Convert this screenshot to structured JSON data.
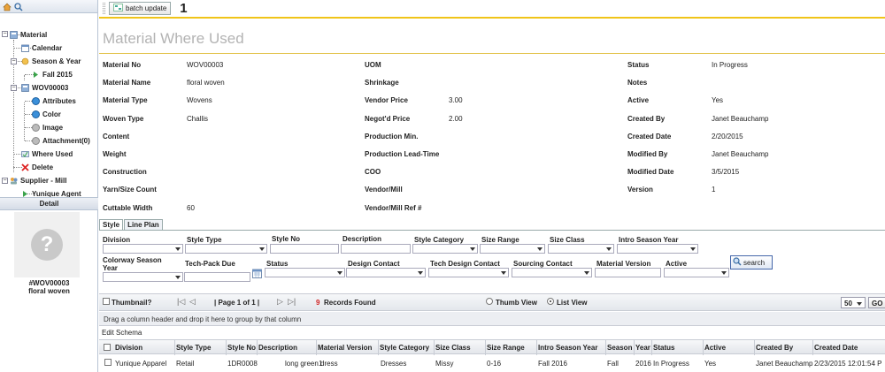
{
  "toolbar": {
    "batch_label": "batch update",
    "annotation": "1"
  },
  "tree": {
    "material": "Material",
    "calendar": "Calendar",
    "season_year": "Season & Year",
    "fall2015": "Fall 2015",
    "wov": "WOV00003",
    "attributes": "Attributes",
    "color": "Color",
    "image": "Image",
    "attachment": "Attachment(0)",
    "where_used": "Where Used",
    "delete": "Delete",
    "supplier": "Supplier - Mill",
    "agent": "Yunique Agent"
  },
  "detail": {
    "title": "Detail",
    "caption1": "#WOV00003",
    "caption2": "floral woven"
  },
  "page_title": "Material Where Used",
  "info": {
    "col1": [
      {
        "label": "Material No",
        "value": "WOV00003"
      },
      {
        "label": "Material Name",
        "value": "floral woven"
      },
      {
        "label": "Material Type",
        "value": "Wovens"
      },
      {
        "label": "Woven Type",
        "value": "Challis"
      },
      {
        "label": "Content",
        "value": ""
      },
      {
        "label": "Weight",
        "value": ""
      },
      {
        "label": "Construction",
        "value": ""
      },
      {
        "label": "Yarn/Size Count",
        "value": ""
      },
      {
        "label": "Cuttable Width",
        "value": "60"
      }
    ],
    "col2": [
      {
        "label": "UOM",
        "value": ""
      },
      {
        "label": "Shrinkage",
        "value": ""
      },
      {
        "label": "Vendor Price",
        "value": "3.00"
      },
      {
        "label": "Negot'd Price",
        "value": "2.00"
      },
      {
        "label": "Production Min.",
        "value": ""
      },
      {
        "label": "Production Lead-Time",
        "value": ""
      },
      {
        "label": "COO",
        "value": ""
      },
      {
        "label": "Vendor/Mill",
        "value": ""
      },
      {
        "label": "Vendor/Mill Ref #",
        "value": ""
      }
    ],
    "col3": [
      {
        "label": "Status",
        "value": "In Progress"
      },
      {
        "label": "Notes",
        "value": ""
      },
      {
        "label": "Active",
        "value": "Yes"
      },
      {
        "label": "Created By",
        "value": "Janet Beauchamp"
      },
      {
        "label": "Created Date",
        "value": "2/20/2015"
      },
      {
        "label": "Modified By",
        "value": "Janet Beauchamp"
      },
      {
        "label": "Modified Date",
        "value": "3/5/2015"
      },
      {
        "label": "Version",
        "value": "1"
      }
    ]
  },
  "tabs": [
    "Style",
    "Line Plan"
  ],
  "filters": {
    "division": "Division",
    "style_type": "Style Type",
    "style_no": "Style No",
    "description": "Description",
    "style_category": "Style Category",
    "size_range": "Size Range",
    "size_class": "Size Class",
    "intro_season": "Intro Season Year",
    "colorway_season_1": "Colorway Season",
    "colorway_season_2": "Year",
    "techpack_due": "Tech-Pack Due",
    "status": "Status",
    "design_contact": "Design Contact",
    "tech_design_contact": "Tech Design Contact",
    "sourcing_contact": "Sourcing Contact",
    "material_version": "Material Version",
    "active": "Active",
    "search": "search"
  },
  "pager": {
    "thumbnail": "Thumbnail?",
    "page_text": "| Page 1 of 1 |",
    "records_count": "9",
    "records_label": "Records Found",
    "thumb_view": "Thumb View",
    "list_view": "List View",
    "page_size": "50",
    "go": "GO"
  },
  "group_hint": "Drag a column header and drop it here to group by that column",
  "edit_schema": "Edit Schema",
  "grid": {
    "headers": [
      "Division",
      "Style Type",
      "Style No",
      "Description",
      "Material Version",
      "Style Category",
      "Size Class",
      "Size Range",
      "Intro Season Year",
      "Season",
      "Year",
      "Status",
      "Active",
      "Created By",
      "Created Date"
    ],
    "row": [
      "Yunique Apparel",
      "Retail",
      "1DR0008",
      "long green dress",
      "1",
      "Dresses",
      "Missy",
      "0-16",
      "Fall 2016",
      "Fall",
      "2016",
      "In Progress",
      "Yes",
      "Janet Beauchamp",
      "2/23/2015 12:01:54 P"
    ]
  }
}
